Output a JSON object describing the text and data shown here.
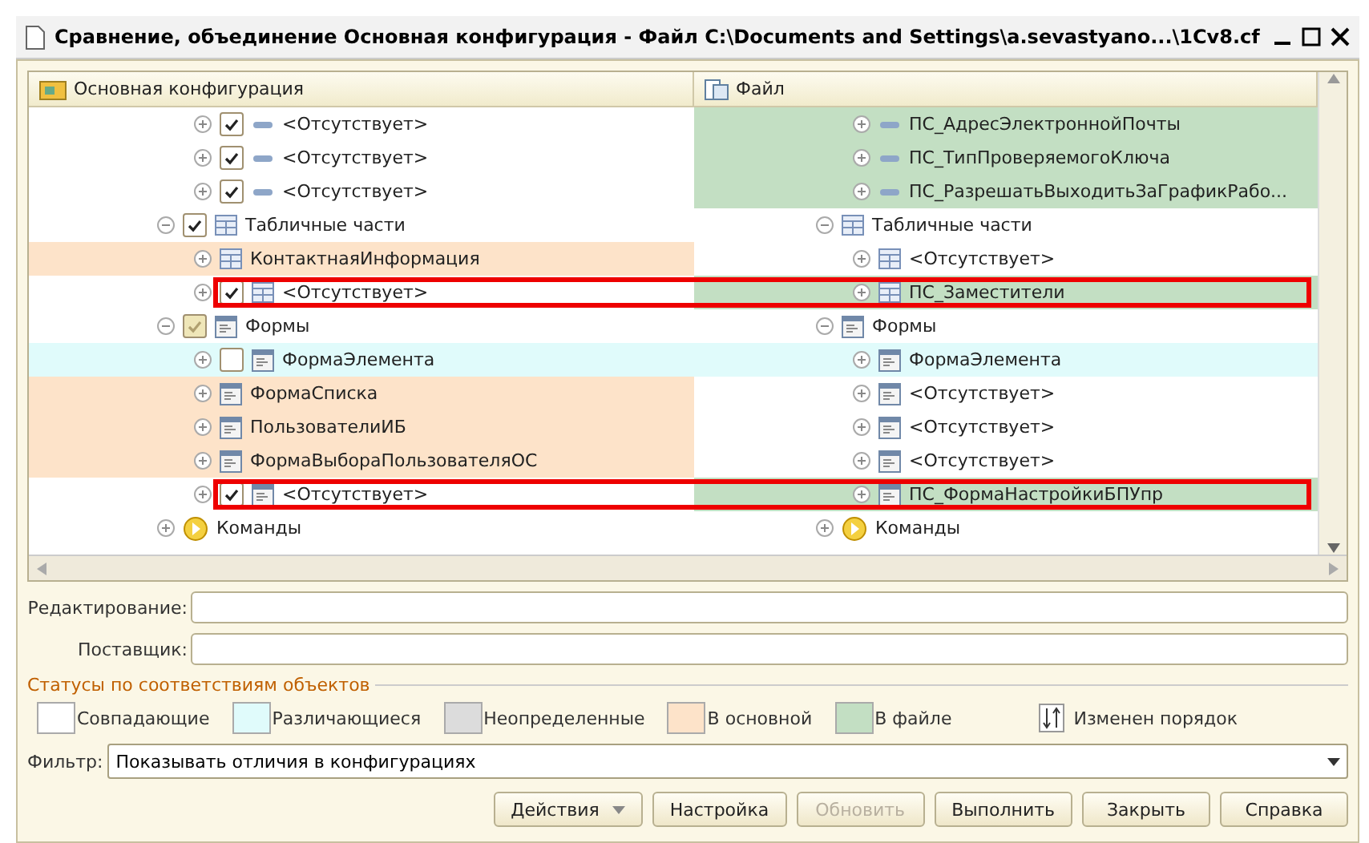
{
  "window": {
    "title": "Сравнение, объединение Основная конфигурация - Файл C:\\Documents and Settings\\a.sevastyano...\\1Cv8.cf"
  },
  "columns": [
    "Основная конфигурация",
    "Файл"
  ],
  "tree": [
    {
      "children": [
        {
          "expanded": false,
          "highlighted": false,
          "left": {
            "text": "<Отсутствует>",
            "kind": "attribute",
            "color": "#ffffff",
            "checked": true
          },
          "right": {
            "text": "ПС_АдресЭлектроннойПочты",
            "kind": "attribute",
            "color": "#c3dfc3"
          }
        },
        {
          "expanded": false,
          "highlighted": false,
          "left": {
            "text": "<Отсутствует>",
            "kind": "attribute",
            "color": "#ffffff",
            "checked": true
          },
          "right": {
            "text": "ПС_ТипПроверяемогоКлюча",
            "kind": "attribute",
            "color": "#c3dfc3"
          }
        },
        {
          "expanded": false,
          "highlighted": false,
          "left": {
            "text": "<Отсутствует>",
            "kind": "attribute",
            "color": "#ffffff",
            "checked": true
          },
          "right": {
            "text": "ПС_РазрешатьВыходитьЗаГрафикРабо...",
            "kind": "attribute",
            "color": "#c3dfc3"
          }
        }
      ]
    },
    {
      "expanded": true,
      "highlighted": false,
      "left": {
        "text": "Табличные части",
        "kind": "table",
        "color": "#ffffff",
        "checked": true
      },
      "right": {
        "text": "Табличные части",
        "kind": "table",
        "color": "#ffffff"
      },
      "children": [
        {
          "expanded": false,
          "highlighted": false,
          "left": {
            "text": "КонтактнаяИнформация",
            "kind": "table",
            "color": "#fde3c9"
          },
          "right": {
            "text": "<Отсутствует>",
            "kind": "table",
            "color": "#ffffff"
          }
        },
        {
          "expanded": false,
          "highlighted": true,
          "left": {
            "text": "<Отсутствует>",
            "kind": "table",
            "color": "#ffffff",
            "checked": true
          },
          "right": {
            "text": "ПС_Заместители",
            "kind": "table",
            "color": "#c3dfc3"
          }
        }
      ]
    },
    {
      "expanded": true,
      "highlighted": false,
      "left": {
        "text": "Формы",
        "kind": "form",
        "color": "#ffffff",
        "checked": true,
        "mixed": true
      },
      "right": {
        "text": "Формы",
        "kind": "form",
        "color": "#ffffff"
      },
      "children": [
        {
          "expanded": false,
          "highlighted": false,
          "left": {
            "text": "ФормаЭлемента",
            "kind": "form",
            "color": "#e0fbfb",
            "checked": false
          },
          "right": {
            "text": "ФормаЭлемента",
            "kind": "form",
            "color": "#e0fbfb"
          }
        },
        {
          "expanded": false,
          "highlighted": false,
          "left": {
            "text": "ФормаСписка",
            "kind": "form",
            "color": "#fde3c9"
          },
          "right": {
            "text": "<Отсутствует>",
            "kind": "form",
            "color": "#ffffff"
          }
        },
        {
          "expanded": false,
          "highlighted": false,
          "left": {
            "text": "ПользователиИБ",
            "kind": "form",
            "color": "#fde3c9"
          },
          "right": {
            "text": "<Отсутствует>",
            "kind": "form",
            "color": "#ffffff"
          }
        },
        {
          "expanded": false,
          "highlighted": false,
          "left": {
            "text": "ФормаВыбораПользователяОС",
            "kind": "form",
            "color": "#fde3c9"
          },
          "right": {
            "text": "<Отсутствует>",
            "kind": "form",
            "color": "#ffffff"
          }
        },
        {
          "expanded": false,
          "highlighted": true,
          "left": {
            "text": "<Отсутствует>",
            "kind": "form",
            "color": "#ffffff",
            "checked": true
          },
          "right": {
            "text": "ПС_ФормаНастройкиБПУпр",
            "kind": "form",
            "color": "#c3dfc3"
          }
        }
      ]
    },
    {
      "expanded": false,
      "highlighted": false,
      "left": {
        "text": "Команды",
        "kind": "commands",
        "color": "#ffffff"
      },
      "right": {
        "text": "Команды",
        "kind": "commands",
        "color": "#ffffff"
      }
    }
  ],
  "fields": [
    {
      "label": "Редактирование:"
    },
    {
      "label": "Поставщик:"
    }
  ],
  "legend": {
    "title": "Статусы по соответствиям объектов",
    "items": [
      {
        "kind": "swatch",
        "label": "Совпадающие",
        "color": "#ffffff"
      },
      {
        "kind": "swatch",
        "label": "Различающиеся",
        "color": "#e0fbfb"
      },
      {
        "kind": "swatch",
        "label": "Неопределенные",
        "color": "#dcdcdc"
      },
      {
        "kind": "swatch",
        "label": "В основной",
        "color": "#fde3c9"
      },
      {
        "kind": "swatch",
        "label": "В файле",
        "color": "#c3dfc3"
      },
      {
        "kind": "order",
        "label": "Изменен порядок"
      }
    ]
  },
  "filter": {
    "label": "Фильтр:",
    "value": "Показывать отличия в конфигурациях"
  },
  "buttons": [
    {
      "label": "Действия",
      "dropdown": true,
      "disabled": false
    },
    {
      "label": "Настройка",
      "dropdown": false,
      "disabled": false
    },
    {
      "label": "Обновить",
      "dropdown": false,
      "disabled": true
    },
    {
      "label": "Выполнить",
      "dropdown": false,
      "disabled": false
    },
    {
      "label": "Закрыть",
      "dropdown": false,
      "disabled": false
    },
    {
      "label": "Справка",
      "dropdown": false,
      "disabled": false
    }
  ]
}
